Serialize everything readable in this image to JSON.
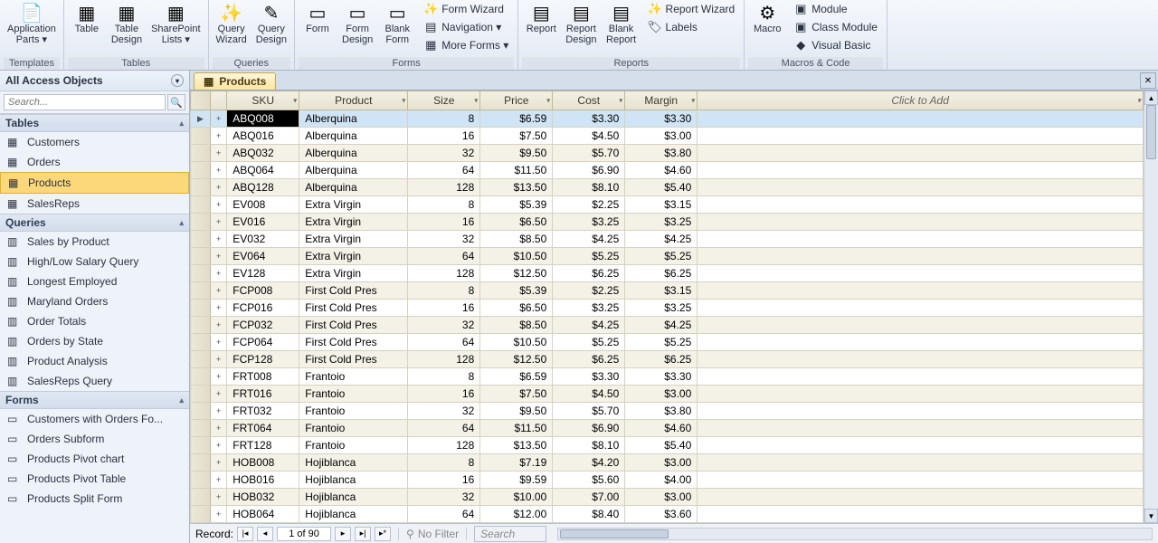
{
  "ribbon": {
    "groups": [
      {
        "label": "Templates",
        "items": [
          {
            "icon": "📄",
            "text": "Application\nParts ▾"
          }
        ]
      },
      {
        "label": "Tables",
        "items": [
          {
            "icon": "▦",
            "text": "Table"
          },
          {
            "icon": "▦",
            "text": "Table\nDesign"
          },
          {
            "icon": "▦",
            "text": "SharePoint\nLists ▾"
          }
        ]
      },
      {
        "label": "Queries",
        "items": [
          {
            "icon": "✨",
            "text": "Query\nWizard"
          },
          {
            "icon": "✎",
            "text": "Query\nDesign"
          }
        ]
      },
      {
        "label": "Forms",
        "items": [
          {
            "icon": "▭",
            "text": "Form"
          },
          {
            "icon": "▭",
            "text": "Form\nDesign"
          },
          {
            "icon": "▭",
            "text": "Blank\nForm"
          }
        ],
        "small": [
          {
            "icon": "✨",
            "text": "Form Wizard"
          },
          {
            "icon": "▤",
            "text": "Navigation ▾"
          },
          {
            "icon": "▦",
            "text": "More Forms ▾"
          }
        ]
      },
      {
        "label": "Reports",
        "items": [
          {
            "icon": "▤",
            "text": "Report"
          },
          {
            "icon": "▤",
            "text": "Report\nDesign"
          },
          {
            "icon": "▤",
            "text": "Blank\nReport"
          }
        ],
        "small": [
          {
            "icon": "✨",
            "text": "Report Wizard"
          },
          {
            "icon": "🏷",
            "text": "Labels"
          }
        ]
      },
      {
        "label": "Macros & Code",
        "items": [
          {
            "icon": "⚙",
            "text": "Macro"
          }
        ],
        "small": [
          {
            "icon": "▣",
            "text": "Module"
          },
          {
            "icon": "▣",
            "text": "Class Module"
          },
          {
            "icon": "◆",
            "text": "Visual Basic"
          }
        ]
      }
    ]
  },
  "nav": {
    "title": "All Access Objects",
    "search_placeholder": "Search...",
    "sections": [
      {
        "label": "Tables",
        "items": [
          "Customers",
          "Orders",
          "Products",
          "SalesReps"
        ],
        "selected": "Products",
        "icon": "▦"
      },
      {
        "label": "Queries",
        "items": [
          "Sales by Product",
          "High/Low Salary Query",
          "Longest Employed",
          "Maryland Orders",
          "Order Totals",
          "Orders by State",
          "Product Analysis",
          "SalesReps Query"
        ],
        "icon": "▥"
      },
      {
        "label": "Forms",
        "items": [
          "Customers with Orders Fo...",
          "Orders Subform",
          "Products Pivot chart",
          "Products Pivot Table",
          "Products Split Form"
        ],
        "icon": "▭"
      }
    ]
  },
  "tab": {
    "label": "Products",
    "icon": "▦"
  },
  "columns": [
    "SKU",
    "Product",
    "Size",
    "Price",
    "Cost",
    "Margin"
  ],
  "click_to_add": "Click to Add",
  "rows": [
    {
      "sku": "ABQ008",
      "product": "Alberquina",
      "size": 8,
      "price": "$6.59",
      "cost": "$3.30",
      "margin": "$3.30",
      "sel": true
    },
    {
      "sku": "ABQ016",
      "product": "Alberquina",
      "size": 16,
      "price": "$7.50",
      "cost": "$4.50",
      "margin": "$3.00"
    },
    {
      "sku": "ABQ032",
      "product": "Alberquina",
      "size": 32,
      "price": "$9.50",
      "cost": "$5.70",
      "margin": "$3.80"
    },
    {
      "sku": "ABQ064",
      "product": "Alberquina",
      "size": 64,
      "price": "$11.50",
      "cost": "$6.90",
      "margin": "$4.60"
    },
    {
      "sku": "ABQ128",
      "product": "Alberquina",
      "size": 128,
      "price": "$13.50",
      "cost": "$8.10",
      "margin": "$5.40"
    },
    {
      "sku": "EV008",
      "product": "Extra Virgin",
      "size": 8,
      "price": "$5.39",
      "cost": "$2.25",
      "margin": "$3.15"
    },
    {
      "sku": "EV016",
      "product": "Extra Virgin",
      "size": 16,
      "price": "$6.50",
      "cost": "$3.25",
      "margin": "$3.25"
    },
    {
      "sku": "EV032",
      "product": "Extra Virgin",
      "size": 32,
      "price": "$8.50",
      "cost": "$4.25",
      "margin": "$4.25"
    },
    {
      "sku": "EV064",
      "product": "Extra Virgin",
      "size": 64,
      "price": "$10.50",
      "cost": "$5.25",
      "margin": "$5.25"
    },
    {
      "sku": "EV128",
      "product": "Extra Virgin",
      "size": 128,
      "price": "$12.50",
      "cost": "$6.25",
      "margin": "$6.25"
    },
    {
      "sku": "FCP008",
      "product": "First Cold Pres",
      "size": 8,
      "price": "$5.39",
      "cost": "$2.25",
      "margin": "$3.15"
    },
    {
      "sku": "FCP016",
      "product": "First Cold Pres",
      "size": 16,
      "price": "$6.50",
      "cost": "$3.25",
      "margin": "$3.25"
    },
    {
      "sku": "FCP032",
      "product": "First Cold Pres",
      "size": 32,
      "price": "$8.50",
      "cost": "$4.25",
      "margin": "$4.25"
    },
    {
      "sku": "FCP064",
      "product": "First Cold Pres",
      "size": 64,
      "price": "$10.50",
      "cost": "$5.25",
      "margin": "$5.25"
    },
    {
      "sku": "FCP128",
      "product": "First Cold Pres",
      "size": 128,
      "price": "$12.50",
      "cost": "$6.25",
      "margin": "$6.25"
    },
    {
      "sku": "FRT008",
      "product": "Frantoio",
      "size": 8,
      "price": "$6.59",
      "cost": "$3.30",
      "margin": "$3.30"
    },
    {
      "sku": "FRT016",
      "product": "Frantoio",
      "size": 16,
      "price": "$7.50",
      "cost": "$4.50",
      "margin": "$3.00"
    },
    {
      "sku": "FRT032",
      "product": "Frantoio",
      "size": 32,
      "price": "$9.50",
      "cost": "$5.70",
      "margin": "$3.80"
    },
    {
      "sku": "FRT064",
      "product": "Frantoio",
      "size": 64,
      "price": "$11.50",
      "cost": "$6.90",
      "margin": "$4.60"
    },
    {
      "sku": "FRT128",
      "product": "Frantoio",
      "size": 128,
      "price": "$13.50",
      "cost": "$8.10",
      "margin": "$5.40"
    },
    {
      "sku": "HOB008",
      "product": "Hojiblanca",
      "size": 8,
      "price": "$7.19",
      "cost": "$4.20",
      "margin": "$3.00"
    },
    {
      "sku": "HOB016",
      "product": "Hojiblanca",
      "size": 16,
      "price": "$9.59",
      "cost": "$5.60",
      "margin": "$4.00"
    },
    {
      "sku": "HOB032",
      "product": "Hojiblanca",
      "size": 32,
      "price": "$10.00",
      "cost": "$7.00",
      "margin": "$3.00"
    },
    {
      "sku": "HOB064",
      "product": "Hojiblanca",
      "size": 64,
      "price": "$12.00",
      "cost": "$8.40",
      "margin": "$3.60"
    }
  ],
  "recnav": {
    "label": "Record:",
    "pos": "1 of 90",
    "filter": "No Filter",
    "search": "Search"
  }
}
